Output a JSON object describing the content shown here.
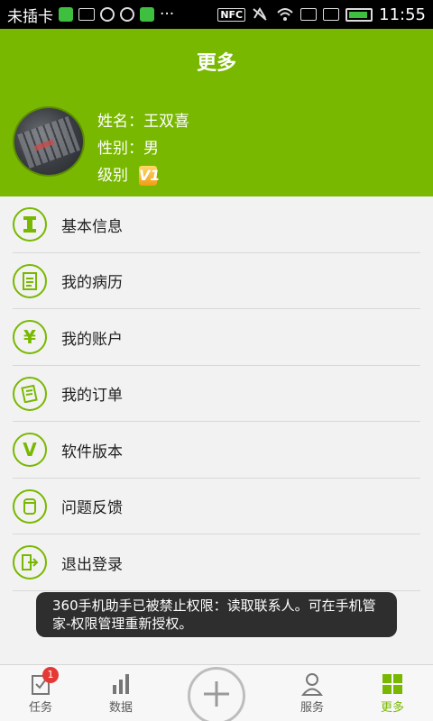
{
  "status_bar": {
    "carrier": "未插卡",
    "nfc": "NFC",
    "time": "11:55"
  },
  "header": {
    "title": "更多"
  },
  "profile": {
    "name_label": "姓名：",
    "name_value": "王双喜",
    "gender_label": "性别：",
    "gender_value": "男",
    "level_label": "级别",
    "level_badge": "V1"
  },
  "menu": {
    "items": [
      {
        "label": "基本信息",
        "icon": "id-card-icon"
      },
      {
        "label": "我的病历",
        "icon": "medical-record-icon"
      },
      {
        "label": "我的账户",
        "icon": "yen-icon"
      },
      {
        "label": "我的订单",
        "icon": "order-icon"
      },
      {
        "label": "软件版本",
        "icon": "version-icon"
      },
      {
        "label": "问题反馈",
        "icon": "feedback-icon"
      },
      {
        "label": "退出登录",
        "icon": "logout-icon"
      }
    ]
  },
  "toast": {
    "text": "360手机助手已被禁止权限：读取联系人。可在手机管家-权限管理重新授权。"
  },
  "bottom_nav": {
    "tasks_label": "任务",
    "tasks_badge": "1",
    "data_label": "数据",
    "service_label": "服务",
    "more_label": "更多"
  },
  "colors": {
    "accent": "#79b800"
  }
}
